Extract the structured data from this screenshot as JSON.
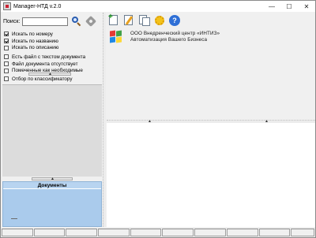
{
  "window": {
    "title": "Manager-НТД v.2.0",
    "controls": {
      "minimize": "—",
      "maximize": "☐",
      "close": "✕"
    }
  },
  "search": {
    "label": "Поиск:",
    "value": "",
    "placeholder": ""
  },
  "filters": [
    {
      "label": "Искать по номеру",
      "checked": true
    },
    {
      "label": "Искать по названию",
      "checked": true
    },
    {
      "label": "Искать по описанию",
      "checked": false
    },
    {
      "label": "Есть файл с текстом документа",
      "checked": false
    },
    {
      "label": "Файл документа отсутствует",
      "checked": false
    },
    {
      "label": "Помеченные как необходимые",
      "checked": false
    },
    {
      "label": "Отбор по классификатору",
      "checked": false
    }
  ],
  "documents_panel": {
    "title": "Документы"
  },
  "toolbar": {
    "icons": [
      "new-document-icon",
      "edit-document-icon",
      "copy-document-icon",
      "settings-icon",
      "help-icon"
    ],
    "help_glyph": "?"
  },
  "company": {
    "line1": "ООО Внедренческий центр «ИНТИЗ»",
    "line2": "Автоматизация Вашего Бизнеса",
    "logo_colors": [
      "#e53935",
      "#43a047",
      "#1e88e5",
      "#fdd835"
    ]
  },
  "icons": {
    "search": "search-icon",
    "clear": "clear-search-icon",
    "app": "app-icon"
  },
  "colors": {
    "documents_bg": "#aacbec",
    "classifier_bg": "#dcdcdc",
    "content_bg": "#ffffff"
  }
}
